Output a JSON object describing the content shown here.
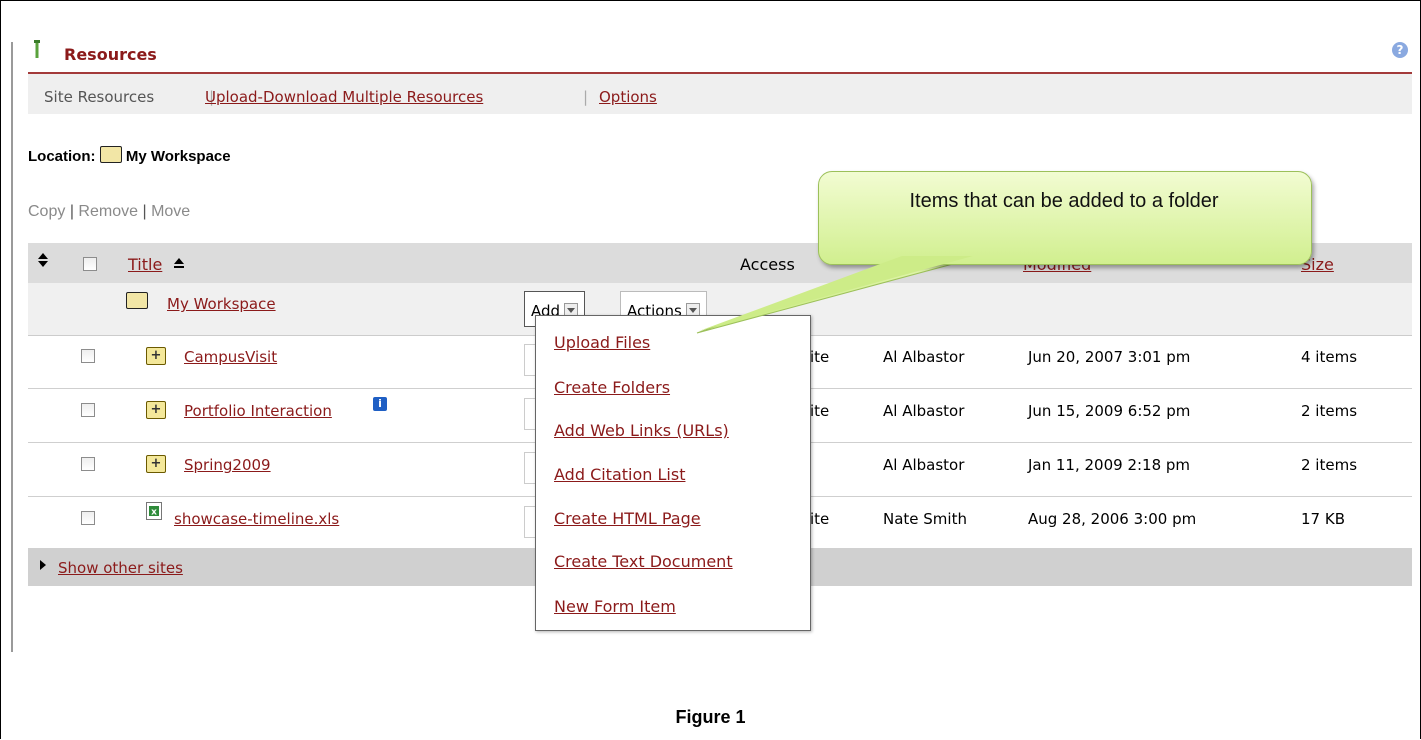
{
  "tool": {
    "title": "Resources",
    "help_icon": "?"
  },
  "nav": {
    "items": [
      "Site Resources",
      "Upload-Download Multiple Resources",
      "Options"
    ]
  },
  "location": {
    "label": "Location:",
    "folder": "My Workspace"
  },
  "commands": {
    "copy": "Copy",
    "remove": "Remove",
    "move": "Move"
  },
  "table": {
    "columns": {
      "title": "Title",
      "access": "Access",
      "modified": "Modified",
      "size": "Size"
    },
    "root": {
      "name": "My Workspace",
      "add_label": "Add",
      "actions_label": "Actions"
    },
    "rows": [
      {
        "name": "CampusVisit",
        "access": "ite",
        "created_by": "Al Albastor",
        "modified": "Jun 20, 2007 3:01 pm",
        "size": "4 items"
      },
      {
        "name": "Portfolio Interaction",
        "access": "ite",
        "created_by": "Al Albastor",
        "modified": "Jun 15, 2009 6:52 pm",
        "size": "2 items"
      },
      {
        "name": "Spring2009",
        "access": "",
        "created_by": "Al Albastor",
        "modified": "Jan 11, 2009 2:18 pm",
        "size": "2 items"
      },
      {
        "name": "showcase-timeline.xls",
        "access": "ite",
        "created_by": "Nate Smith",
        "modified": "Aug 28, 2006 3:00 pm",
        "size": "17 KB"
      }
    ]
  },
  "footer": {
    "show_other_sites": "Show other sites"
  },
  "add_menu": {
    "items": [
      "Upload Files",
      "Create Folders",
      "Add Web Links (URLs)",
      "Add Citation List",
      "Create HTML Page",
      "Create Text Document",
      "New Form Item"
    ]
  },
  "callout": {
    "text": "Items that can be added to a folder"
  },
  "caption": "Figure 1"
}
